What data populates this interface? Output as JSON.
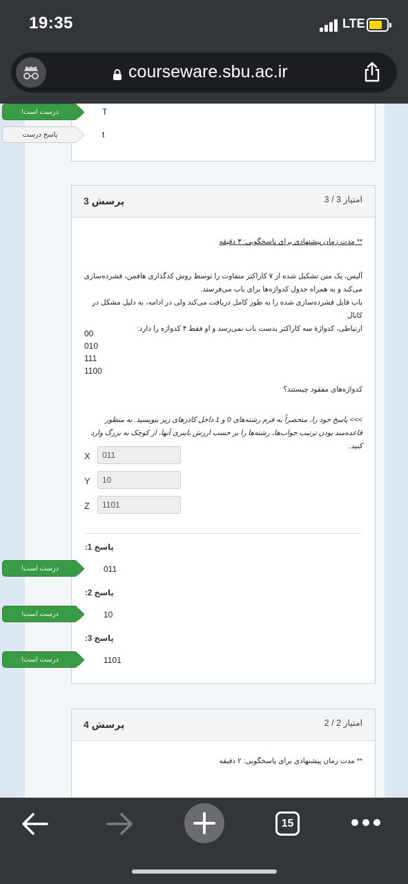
{
  "status": {
    "time": "19:35",
    "network": "LTE"
  },
  "browser": {
    "url": "courseware.sbu.ac.ir",
    "tab_count": "15"
  },
  "prev_question": {
    "rows": [
      {
        "tag": "درست است!",
        "value": "T"
      },
      {
        "tag": "پاسخ درست",
        "value": "t"
      }
    ]
  },
  "q3": {
    "title": "پرسش 3",
    "score": "امتیاز 3 / 3",
    "time_note": "** مدت زمان پیشنهادی برای پاسخگویی: ۳ دقیقه",
    "body_lines": [
      "آلیس، یک متن تشکیل شده از ۷ کاراکتر متفاوت را توسط روش کدگذاری هافمن، فشرده‌سازی",
      "می‌کند و به همراه جدول کدواژه‌ها برای باب می‌فرستد.",
      "باب فایل فشرده‌سازی شده را به طور کامل دریافت می‌کند ولی در ادامه، به دلیل مشکل در کانال",
      "ارتباطی، کدواژۀ سه کاراکتر بدست باب نمی‌رسد و او فقط ۴ کدواژه را دارد:"
    ],
    "codes": [
      "00",
      "010",
      "111",
      "1100"
    ],
    "question": "کدواژه‌های مفقود چیستند؟",
    "instruction_lines": [
      ">>> پاسخ خود را، منحصراً به فرم رشته‌های 0 و 1 داخل کادرهای زیر بنویسید. به منظور",
      "قاعده‌مند بودن ترتیب جواب‌ها، رشته‌ها را بر حسب ارزش باینری آنها، از کوچک به بزرگ وارد کنید."
    ],
    "fields": [
      {
        "label": "X",
        "value": "011"
      },
      {
        "label": "Y",
        "value": "10"
      },
      {
        "label": "Z",
        "value": "1101"
      }
    ],
    "answers": [
      {
        "label": "پاسخ 1:",
        "value": "011",
        "tag": "درست است!"
      },
      {
        "label": "پاسخ 2:",
        "value": "10",
        "tag": "درست است!"
      },
      {
        "label": "پاسخ 3:",
        "value": "1101",
        "tag": "درست است!"
      }
    ]
  },
  "q4": {
    "title": "پرسش 4",
    "score": "امتیاز 2 / 2",
    "time_note": "** مدت زمان پیشنهادی برای پاسخگویی: ۲ دقیقه"
  },
  "colors": {
    "correct": "#3a9b46",
    "background": "#dde9f2",
    "chrome": "#323539"
  }
}
